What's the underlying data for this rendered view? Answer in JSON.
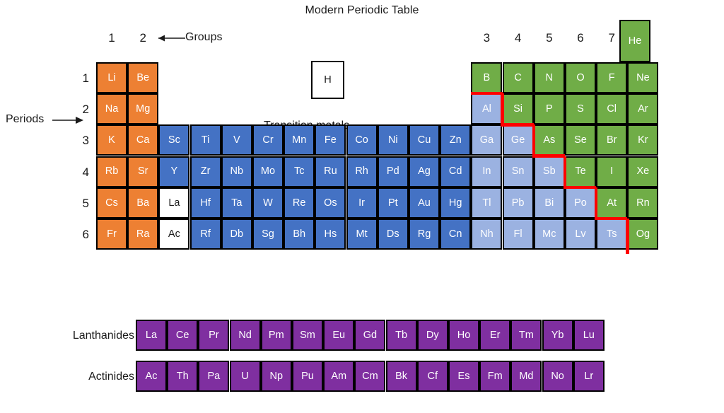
{
  "title": "Modern Periodic Table",
  "labels": {
    "groups": "Groups",
    "periods": "Periods",
    "transition_metals": "Transition metals",
    "lanthanides": "Lanthanides",
    "actinides": "Actinides"
  },
  "group_numbers": [
    "1",
    "2",
    "3",
    "4",
    "5",
    "6",
    "7"
  ],
  "period_numbers": [
    "1",
    "2",
    "3",
    "4",
    "5",
    "6"
  ],
  "colors": {
    "alkali_orange": "#ED8033",
    "transition_blue": "#4472C4",
    "post_transition_light_blue": "#9BB2E1",
    "nonmetal_green": "#70AD47",
    "lanthanide_purple": "#7F2FA0",
    "white_cell": "#FFFFFF",
    "staircase_red": "#FF0000",
    "border_black": "#000000"
  },
  "hydrogen": {
    "symbol": "H",
    "category": "white"
  },
  "helium": {
    "symbol": "He",
    "category": "nonmetal"
  },
  "main_grid": {
    "rows": 6,
    "columns": 18,
    "cells": [
      {
        "symbol": "Li",
        "row": 1,
        "col": 1,
        "category": "alkali"
      },
      {
        "symbol": "Be",
        "row": 1,
        "col": 2,
        "category": "alkali"
      },
      {
        "symbol": "B",
        "row": 1,
        "col": 13,
        "category": "nonmetal"
      },
      {
        "symbol": "C",
        "row": 1,
        "col": 14,
        "category": "nonmetal"
      },
      {
        "symbol": "N",
        "row": 1,
        "col": 15,
        "category": "nonmetal"
      },
      {
        "symbol": "O",
        "row": 1,
        "col": 16,
        "category": "nonmetal"
      },
      {
        "symbol": "F",
        "row": 1,
        "col": 17,
        "category": "nonmetal"
      },
      {
        "symbol": "Ne",
        "row": 1,
        "col": 18,
        "category": "nonmetal"
      },
      {
        "symbol": "Na",
        "row": 2,
        "col": 1,
        "category": "alkali"
      },
      {
        "symbol": "Mg",
        "row": 2,
        "col": 2,
        "category": "alkali"
      },
      {
        "symbol": "Al",
        "row": 2,
        "col": 13,
        "category": "post"
      },
      {
        "symbol": "Si",
        "row": 2,
        "col": 14,
        "category": "nonmetal"
      },
      {
        "symbol": "P",
        "row": 2,
        "col": 15,
        "category": "nonmetal"
      },
      {
        "symbol": "S",
        "row": 2,
        "col": 16,
        "category": "nonmetal"
      },
      {
        "symbol": "Cl",
        "row": 2,
        "col": 17,
        "category": "nonmetal"
      },
      {
        "symbol": "Ar",
        "row": 2,
        "col": 18,
        "category": "nonmetal"
      },
      {
        "symbol": "K",
        "row": 3,
        "col": 1,
        "category": "alkali"
      },
      {
        "symbol": "Ca",
        "row": 3,
        "col": 2,
        "category": "alkali"
      },
      {
        "symbol": "Sc",
        "row": 3,
        "col": 3,
        "category": "trans"
      },
      {
        "symbol": "Ti",
        "row": 3,
        "col": 4,
        "category": "trans"
      },
      {
        "symbol": "V",
        "row": 3,
        "col": 5,
        "category": "trans"
      },
      {
        "symbol": "Cr",
        "row": 3,
        "col": 6,
        "category": "trans"
      },
      {
        "symbol": "Mn",
        "row": 3,
        "col": 7,
        "category": "trans"
      },
      {
        "symbol": "Fe",
        "row": 3,
        "col": 8,
        "category": "trans"
      },
      {
        "symbol": "Co",
        "row": 3,
        "col": 9,
        "category": "trans"
      },
      {
        "symbol": "Ni",
        "row": 3,
        "col": 10,
        "category": "trans"
      },
      {
        "symbol": "Cu",
        "row": 3,
        "col": 11,
        "category": "trans"
      },
      {
        "symbol": "Zn",
        "row": 3,
        "col": 12,
        "category": "trans"
      },
      {
        "symbol": "Ga",
        "row": 3,
        "col": 13,
        "category": "post"
      },
      {
        "symbol": "Ge",
        "row": 3,
        "col": 14,
        "category": "post"
      },
      {
        "symbol": "As",
        "row": 3,
        "col": 15,
        "category": "nonmetal"
      },
      {
        "symbol": "Se",
        "row": 3,
        "col": 16,
        "category": "nonmetal"
      },
      {
        "symbol": "Br",
        "row": 3,
        "col": 17,
        "category": "nonmetal"
      },
      {
        "symbol": "Kr",
        "row": 3,
        "col": 18,
        "category": "nonmetal"
      },
      {
        "symbol": "Rb",
        "row": 4,
        "col": 1,
        "category": "alkali"
      },
      {
        "symbol": "Sr",
        "row": 4,
        "col": 2,
        "category": "alkali"
      },
      {
        "symbol": "Y",
        "row": 4,
        "col": 3,
        "category": "trans"
      },
      {
        "symbol": "Zr",
        "row": 4,
        "col": 4,
        "category": "trans"
      },
      {
        "symbol": "Nb",
        "row": 4,
        "col": 5,
        "category": "trans"
      },
      {
        "symbol": "Mo",
        "row": 4,
        "col": 6,
        "category": "trans"
      },
      {
        "symbol": "Tc",
        "row": 4,
        "col": 7,
        "category": "trans"
      },
      {
        "symbol": "Ru",
        "row": 4,
        "col": 8,
        "category": "trans"
      },
      {
        "symbol": "Rh",
        "row": 4,
        "col": 9,
        "category": "trans"
      },
      {
        "symbol": "Pd",
        "row": 4,
        "col": 10,
        "category": "trans"
      },
      {
        "symbol": "Ag",
        "row": 4,
        "col": 11,
        "category": "trans"
      },
      {
        "symbol": "Cd",
        "row": 4,
        "col": 12,
        "category": "trans"
      },
      {
        "symbol": "In",
        "row": 4,
        "col": 13,
        "category": "post"
      },
      {
        "symbol": "Sn",
        "row": 4,
        "col": 14,
        "category": "post"
      },
      {
        "symbol": "Sb",
        "row": 4,
        "col": 15,
        "category": "post"
      },
      {
        "symbol": "Te",
        "row": 4,
        "col": 16,
        "category": "nonmetal"
      },
      {
        "symbol": "I",
        "row": 4,
        "col": 17,
        "category": "nonmetal"
      },
      {
        "symbol": "Xe",
        "row": 4,
        "col": 18,
        "category": "nonmetal"
      },
      {
        "symbol": "Cs",
        "row": 5,
        "col": 1,
        "category": "alkali"
      },
      {
        "symbol": "Ba",
        "row": 5,
        "col": 2,
        "category": "alkali"
      },
      {
        "symbol": "La",
        "row": 5,
        "col": 3,
        "category": "white"
      },
      {
        "symbol": "Hf",
        "row": 5,
        "col": 4,
        "category": "trans"
      },
      {
        "symbol": "Ta",
        "row": 5,
        "col": 5,
        "category": "trans"
      },
      {
        "symbol": "W",
        "row": 5,
        "col": 6,
        "category": "trans"
      },
      {
        "symbol": "Re",
        "row": 5,
        "col": 7,
        "category": "trans"
      },
      {
        "symbol": "Os",
        "row": 5,
        "col": 8,
        "category": "trans"
      },
      {
        "symbol": "Ir",
        "row": 5,
        "col": 9,
        "category": "trans"
      },
      {
        "symbol": "Pt",
        "row": 5,
        "col": 10,
        "category": "trans"
      },
      {
        "symbol": "Au",
        "row": 5,
        "col": 11,
        "category": "trans"
      },
      {
        "symbol": "Hg",
        "row": 5,
        "col": 12,
        "category": "trans"
      },
      {
        "symbol": "Tl",
        "row": 5,
        "col": 13,
        "category": "post"
      },
      {
        "symbol": "Pb",
        "row": 5,
        "col": 14,
        "category": "post"
      },
      {
        "symbol": "Bi",
        "row": 5,
        "col": 15,
        "category": "post"
      },
      {
        "symbol": "Po",
        "row": 5,
        "col": 16,
        "category": "post"
      },
      {
        "symbol": "At",
        "row": 5,
        "col": 17,
        "category": "nonmetal"
      },
      {
        "symbol": "Rn",
        "row": 5,
        "col": 18,
        "category": "nonmetal"
      },
      {
        "symbol": "Fr",
        "row": 6,
        "col": 1,
        "category": "alkali"
      },
      {
        "symbol": "Ra",
        "row": 6,
        "col": 2,
        "category": "alkali"
      },
      {
        "symbol": "Ac",
        "row": 6,
        "col": 3,
        "category": "white"
      },
      {
        "symbol": "Rf",
        "row": 6,
        "col": 4,
        "category": "trans"
      },
      {
        "symbol": "Db",
        "row": 6,
        "col": 5,
        "category": "trans"
      },
      {
        "symbol": "Sg",
        "row": 6,
        "col": 6,
        "category": "trans"
      },
      {
        "symbol": "Bh",
        "row": 6,
        "col": 7,
        "category": "trans"
      },
      {
        "symbol": "Hs",
        "row": 6,
        "col": 8,
        "category": "trans"
      },
      {
        "symbol": "Mt",
        "row": 6,
        "col": 9,
        "category": "trans"
      },
      {
        "symbol": "Ds",
        "row": 6,
        "col": 10,
        "category": "trans"
      },
      {
        "symbol": "Rg",
        "row": 6,
        "col": 11,
        "category": "trans"
      },
      {
        "symbol": "Cn",
        "row": 6,
        "col": 12,
        "category": "trans"
      },
      {
        "symbol": "Nh",
        "row": 6,
        "col": 13,
        "category": "post"
      },
      {
        "symbol": "Fl",
        "row": 6,
        "col": 14,
        "category": "post"
      },
      {
        "symbol": "Mc",
        "row": 6,
        "col": 15,
        "category": "post"
      },
      {
        "symbol": "Lv",
        "row": 6,
        "col": 16,
        "category": "post"
      },
      {
        "symbol": "Ts",
        "row": 6,
        "col": 17,
        "category": "post"
      },
      {
        "symbol": "Og",
        "row": 6,
        "col": 18,
        "category": "nonmetal"
      }
    ]
  },
  "lanthanide_series": [
    "La",
    "Ce",
    "Pr",
    "Nd",
    "Pm",
    "Sm",
    "Eu",
    "Gd",
    "Tb",
    "Dy",
    "Ho",
    "Er",
    "Tm",
    "Yb",
    "Lu"
  ],
  "actinide_series": [
    "Ac",
    "Th",
    "Pa",
    "U",
    "Np",
    "Pu",
    "Am",
    "Cm",
    "Bk",
    "Cf",
    "Es",
    "Fm",
    "Md",
    "No",
    "Lr"
  ],
  "staircase": {
    "description": "red metal/nonmetal dividing line",
    "color": "#FF0000"
  }
}
